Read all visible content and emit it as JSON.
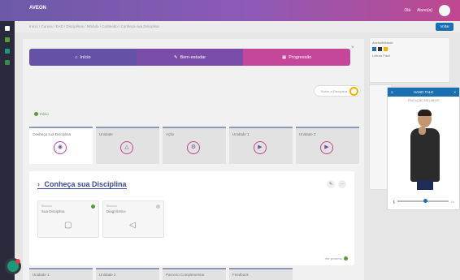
{
  "app": {
    "brand": "AVEON"
  },
  "header": {
    "user_label": "Olá",
    "user_name": "Aluno(a)"
  },
  "breadcrumb": {
    "text": "Início / Cursos / EAD / Disciplinas / Módulo / Conteúdo / Conheça sua Disciplina",
    "button": "Voltar"
  },
  "tabs": [
    {
      "label": "Início",
      "icon": "home-icon"
    },
    {
      "label": "Bem-estudar",
      "icon": "book-icon"
    },
    {
      "label": "Progressão",
      "icon": "chart-icon"
    }
  ],
  "sobre": {
    "label": "Sobre a Disciplina"
  },
  "inicio": {
    "label": "Início"
  },
  "cards": [
    {
      "title": "Conheça sua Disciplina",
      "icon": "user-icon",
      "active": true
    },
    {
      "title": "Unidade",
      "icon": "network-icon",
      "active": false
    },
    {
      "title": "Ação",
      "icon": "gear-icon",
      "active": false
    },
    {
      "title": "Unidade 1",
      "icon": "play-icon",
      "active": false
    },
    {
      "title": "Unidade 2",
      "icon": "play-icon",
      "active": false
    }
  ],
  "panel": {
    "title": "Conheça sua Disciplina",
    "sub_cards": [
      {
        "label": "Recurso",
        "title": "Sua Disciplina",
        "status_color": "#5a9a3a",
        "icon": "document-icon"
      },
      {
        "label": "Recurso",
        "title": "Diagnóstico",
        "status_color": "#cccccc",
        "icon": "megaphone-icon"
      }
    ],
    "next": "Ver próximo"
  },
  "bottom_cards": [
    "Unidade 1",
    "Unidade 2",
    "Parceiro Complementar",
    "Feedback"
  ],
  "right_panel": {
    "title": "Acessibilidade",
    "item": "Leitura Fácil"
  },
  "avatar_widget": {
    "title": "HAND TALK",
    "subtitle": "TRADUÇÃO EM LIBRAS",
    "speed": "1x"
  }
}
